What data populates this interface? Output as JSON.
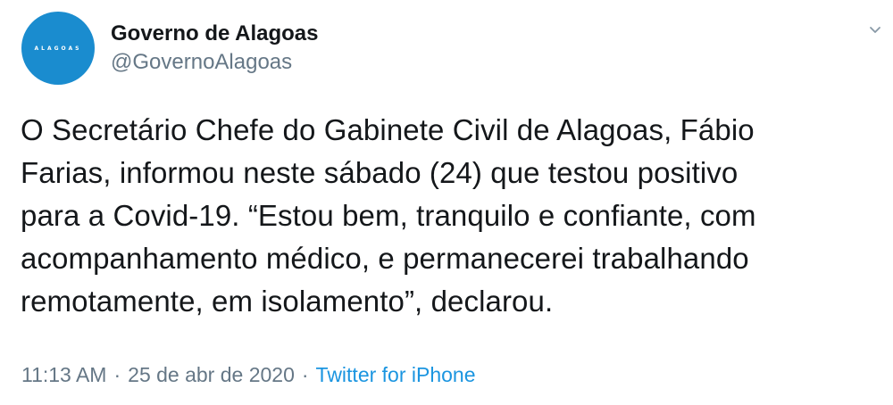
{
  "account": {
    "avatar_text": "ALAGOAS",
    "display_name": "Governo de Alagoas",
    "handle": "@GovernoAlagoas"
  },
  "tweet": {
    "lines": [
      "O Secretário Chefe do Gabinete Civil de Alagoas, Fábio",
      "Farias, informou neste sábado (24) que testou positivo",
      "para a Covid-19. “Estou bem, tranquilo e confiante, com",
      "acompanhamento médico, e permanecerei trabalhando",
      "remotamente, em isolamento”, declarou."
    ]
  },
  "meta": {
    "time": "11:13 AM",
    "separator": "·",
    "date": "25 de abr de 2020",
    "source": "Twitter for iPhone"
  },
  "icons": {
    "menu": "chevron-down-icon"
  },
  "colors": {
    "avatar_bg": "#1a8ccf",
    "text": "#14171a",
    "secondary": "#657786",
    "link": "#1b95e0"
  }
}
